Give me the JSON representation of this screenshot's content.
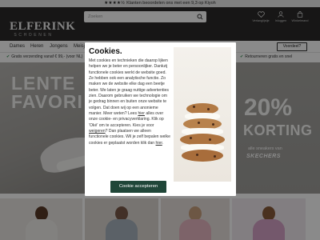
{
  "top_bar": {
    "stars": "★★★★½",
    "text": "Klanten beoordelen ons met een 9,3 op Kiyoh"
  },
  "header": {
    "logo_main": "ELFERINK",
    "logo_sub": "SCHOENEN",
    "search_placeholder": "Zoeken",
    "icons": [
      {
        "icon": "heart-icon",
        "label": "Verlanglijstje"
      },
      {
        "icon": "user-icon",
        "label": "Inloggen"
      },
      {
        "icon": "bag-icon",
        "label": "Winkelmand"
      }
    ]
  },
  "nav": {
    "items": [
      "Dames",
      "Heren",
      "Jongens",
      "Meisjes"
    ],
    "voordeel_button": "Voordeel?"
  },
  "usp": {
    "left": "Gratis verzending vanaf € 99,- (voor NL)",
    "right": "Retourneren gratis en snel"
  },
  "hero": {
    "left_title_1": "LENTE",
    "left_title_2": "FAVORI",
    "percentage": "20%",
    "korting": "KORTING",
    "sub": "alle sneakers van",
    "brand": "SKECHERS"
  },
  "cookie_modal": {
    "title": "Cookies.",
    "text_1": "Met cookies en technieken die daarop lijken helpen we je beter en persoonlijker. Dankzij functionele cookies werkt de website goed. Ze hebben ook een analytische functie. Zo maken we de website elke dag een beetje beter. We laten je graag nuttige advertenties zien. Daarom gebruiken we technologie om je gedrag binnen en buiten onze website te volgen. Dat doen wij op een anonieme manier. Meer weten? Lees",
    "link_1": "hier",
    "text_2": "alles over onze cookie- en privacyverklaring. Klik op 'Oké' om te accepteren. Kies je voor",
    "link_2": "weigeren",
    "text_3": "? Dan plaatsen we alleen functionele cookies. Wil je zelf bepalen welke cookies er geplaatst worden klik dan",
    "link_3": "hier",
    "text_4": ".",
    "accept_button": "Cookie accepteren"
  },
  "colors": {
    "header_bg": "#2b2a29",
    "accept_button_bg": "#1f4638",
    "usp_check": "#2d8a4a"
  }
}
